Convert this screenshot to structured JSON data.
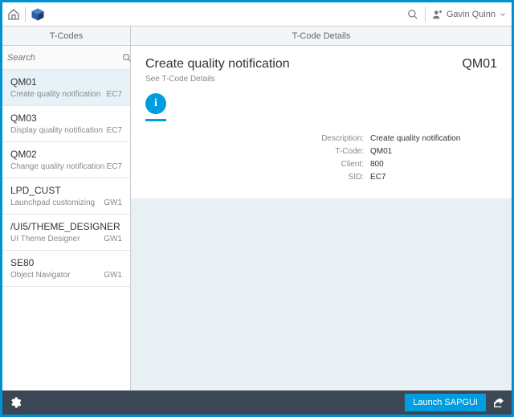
{
  "header": {
    "user_name": "Gavin Quinn"
  },
  "columns": {
    "list_title": "T-Codes",
    "detail_title": "T-Code Details"
  },
  "search": {
    "placeholder": "Search"
  },
  "items": [
    {
      "code": "QM01",
      "desc": "Create quality notification",
      "tag": "EC7",
      "selected": true
    },
    {
      "code": "QM03",
      "desc": "Display quality notification",
      "tag": "EC7",
      "selected": false
    },
    {
      "code": "QM02",
      "desc": "Change quality notification",
      "tag": "EC7",
      "selected": false
    },
    {
      "code": "LPD_CUST",
      "desc": "Launchpad customizing",
      "tag": "GW1",
      "selected": false
    },
    {
      "code": "/UI5/THEME_DESIGNER",
      "desc": "UI Theme Designer",
      "tag": "GW1",
      "selected": false
    },
    {
      "code": "SE80",
      "desc": "Object Navigator",
      "tag": "GW1",
      "selected": false
    }
  ],
  "detail": {
    "title": "Create quality notification",
    "code": "QM01",
    "sub": "See T-Code Details",
    "fields": {
      "description_label": "Description:",
      "description_value": "Create quality notification",
      "tcode_label": "T-Code:",
      "tcode_value": "QM01",
      "client_label": "Client:",
      "client_value": "800",
      "sid_label": "SID:",
      "sid_value": "EC7"
    }
  },
  "footer": {
    "launch_label": "Launch SAPGUI"
  }
}
